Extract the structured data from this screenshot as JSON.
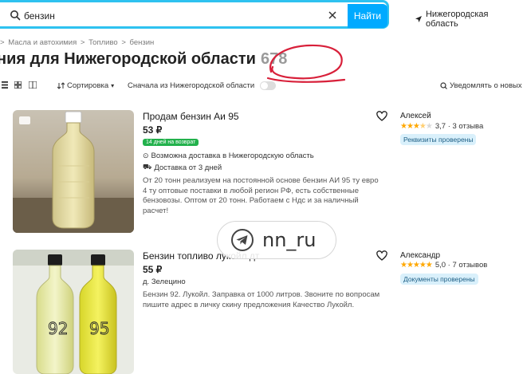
{
  "search": {
    "value": "бензин",
    "find_label": "Найти",
    "region": "Нижегородская область"
  },
  "breadcrumb": [
    "Масла и автохимия",
    "Топливо",
    "бензин"
  ],
  "header": {
    "title": "ния для Нижегородской области",
    "count": "678"
  },
  "toolbar": {
    "sort_label": "Сортировка",
    "region_filter_label": "Сначала из Нижегородской области",
    "notify_label": "Уведомлять о новых"
  },
  "listings": [
    {
      "title": "Продам бензин Аи 95",
      "price": "53 ₽",
      "return_badge": "14 дней на возврат",
      "delivery_possible": "Возможна доставка в Нижегородскую область",
      "delivery_time": "Доставка от 3 дней",
      "description": "От 20 тонн реализуем на постоянной основе бензин АИ 95 ту евро 4 ту оптовые поставки в любой регион РФ, есть собственные бензовозы. Оптом от 20 тонн. Работаем с Ндс и за наличный расчет!",
      "seller": "Алексей",
      "rating": 3.7,
      "rating_text": "3,7 · 3 отзыва",
      "verified": "Реквизиты проверены"
    },
    {
      "title": "Бензин топливо лукойл дт",
      "price": "55 ₽",
      "location": "д. Зелецино",
      "description": "Бензин 92. Лукойл. Заправка от 1000 литров. Звоните по вопросам пишите адрес в личку скину предложения Качество Лукойл.",
      "seller": "Александр",
      "rating": 5.0,
      "rating_text": "5,0 · 7 отзывов",
      "verified": "Документы проверены",
      "bottle_labels": [
        "92",
        "95"
      ]
    }
  ],
  "watermark": {
    "text": "nn_ru"
  },
  "colors": {
    "accent": "#00aaff",
    "search_border": "#2ec2f0",
    "annotation_red": "#d8203a",
    "star": "#ffa800",
    "badge_green": "#22b14c"
  }
}
